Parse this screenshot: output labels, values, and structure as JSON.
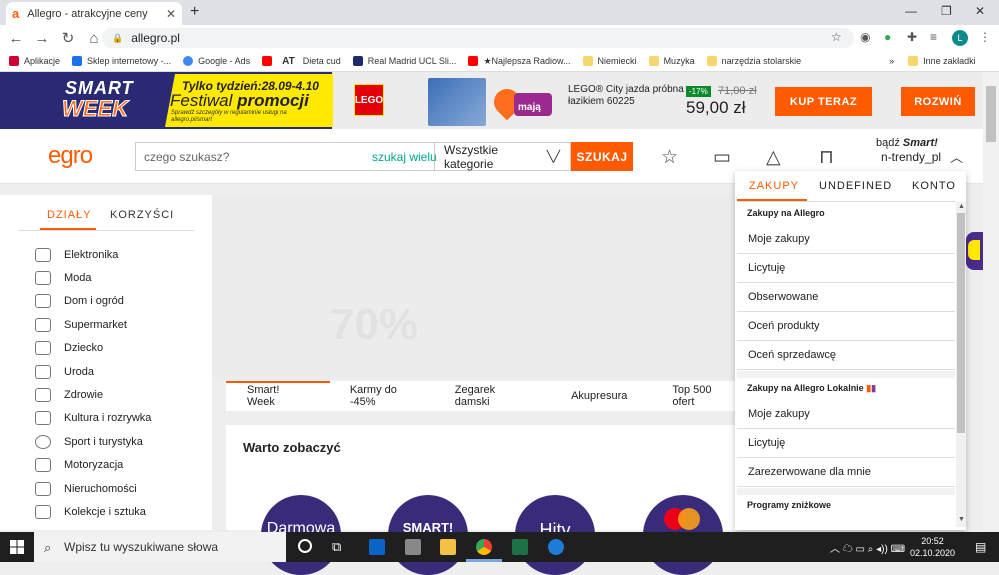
{
  "browser": {
    "tab_title": "Allegro - atrakcyjne ceny",
    "tab_favicon": "a",
    "url": "allegro.pl",
    "bookmarks": [
      {
        "label": "Aplikacje",
        "color": "#c03"
      },
      {
        "label": "Sklep internetowy -...",
        "color": "#1a73e8"
      },
      {
        "label": "Google - Ads",
        "color": "#4285f4"
      },
      {
        "label": "",
        "color": "#f00"
      },
      {
        "label": "Dieta cud",
        "color": "#111"
      },
      {
        "label": "Real Madrid UCL Sli...",
        "color": "#1d2a6d"
      },
      {
        "label": "★Najlepsza Radiow...",
        "color": "#f00"
      },
      {
        "label": "Niemiecki",
        "color": "#f5d76e"
      },
      {
        "label": "Muzyka",
        "color": "#f5d76e"
      },
      {
        "label": "narzędzia stolarskie",
        "color": "#f5d76e"
      },
      {
        "label": "Inne zakładki",
        "color": "#f5d76e"
      }
    ],
    "at_label": "AT",
    "more": "»",
    "profile_initial": "L"
  },
  "banner": {
    "smart": "SMART",
    "week": "WEEK",
    "tagline": "Tylko tydzień:28.09-4.10",
    "festival_a": "Festiwal ",
    "festival_b": "promocji",
    "rules": "Sprawdź szczegóły w regulaminie usługi na allegro.pl/smart",
    "lego": "LEGO",
    "maja": "mają",
    "product_line1": "LEGO® City jazda próbna",
    "product_line2": "łazikiem 60225",
    "discount": "-17%",
    "old_price": "71,00 zł",
    "new_price": "59,00 zł",
    "buy_label": "KUP TERAZ",
    "expand_label": "ROZWIŃ"
  },
  "header": {
    "logo": "egro",
    "search_placeholder": "czego szukasz?",
    "search_more": "szukaj wielu",
    "category": "Wszystkie kategorie",
    "search_button": "SZUKAJ",
    "badz": "bądź ",
    "smart": "Smart!",
    "username": "n-trendy_pl"
  },
  "left_panel": {
    "tab_active": "DZIAŁY",
    "tab_other": "KORZYŚCI",
    "categories": [
      "Elektronika",
      "Moda",
      "Dom i ogród",
      "Supermarket",
      "Dziecko",
      "Uroda",
      "Zdrowie",
      "Kultura i rozrywka",
      "Sport i turystyka",
      "Motoryzacja",
      "Nieruchomości",
      "Kolekcje i sztuka"
    ]
  },
  "main": {
    "hero_text": "70%",
    "nav_tabs": [
      "Smart! Week",
      "Karmy do -45%",
      "Zegarek damski",
      "Akupresura",
      "Top 500 ofert"
    ],
    "warto_title": "Warto zobaczyć",
    "circles": [
      "Darmowa",
      "SMART!",
      "Hity",
      ""
    ]
  },
  "dropdown": {
    "tabs": [
      "ZAKUPY",
      "UNDEFINED",
      "KONTO"
    ],
    "section1": "Zakupy na Allegro",
    "items1": [
      "Moje zakupy",
      "Licytuję",
      "Obserwowane",
      "Oceń produkty",
      "Oceń sprzedawcę"
    ],
    "section2": "Zakupy na Allegro Lokalnie",
    "items2": [
      "Moje zakupy",
      "Licytuję",
      "Zarezerwowane dla mnie"
    ],
    "section3": "Programy zniżkowe"
  },
  "taskbar": {
    "search_placeholder": "Wpisz tu wyszukiwane słowa",
    "time": "20:52",
    "date": "02.10.2020"
  }
}
